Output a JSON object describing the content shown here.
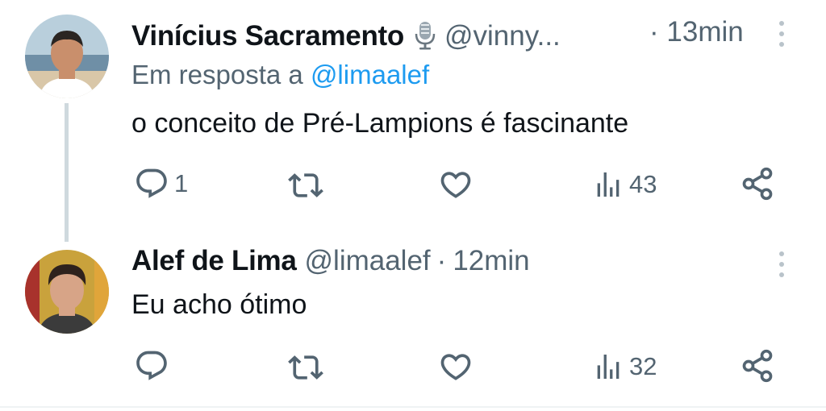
{
  "tweets": [
    {
      "author_name": "Vinícius Sacramento",
      "badge_icon": "microphone-icon",
      "handle": "@vinny...",
      "separator": "·",
      "time": "13min",
      "reply_prefix": "Em resposta a",
      "reply_mention": "@limaalef",
      "text": "o conceito de Pré-Lampions é fascinante",
      "replies": "1",
      "retweets": "",
      "likes": "",
      "views": "43"
    },
    {
      "author_name": "Alef de Lima",
      "handle": "@limaalef",
      "separator": "·",
      "time": "12min",
      "text": "Eu acho ótimo",
      "replies": "",
      "retweets": "",
      "likes": "",
      "views": "32"
    }
  ],
  "colors": {
    "text": "#0f1419",
    "secondary": "#536471",
    "mention": "#1d9bf0",
    "thread_line": "#cfd9de"
  },
  "icons": [
    "reply-icon",
    "retweet-icon",
    "like-icon",
    "views-icon",
    "share-icon",
    "more-icon"
  ]
}
